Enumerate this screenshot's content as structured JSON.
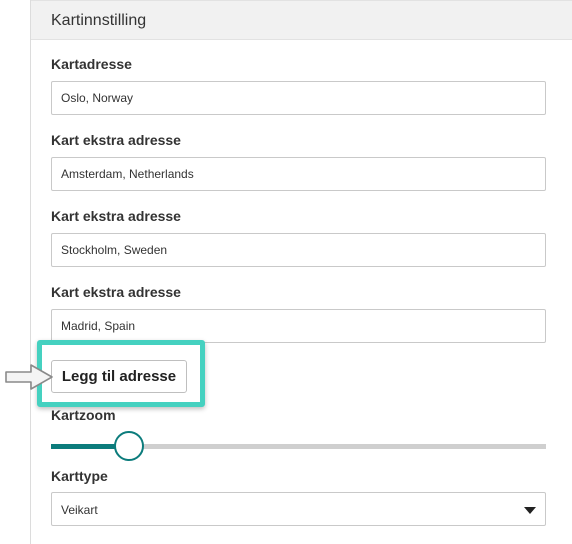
{
  "section": {
    "title": "Kartinnstilling"
  },
  "map_address": {
    "label": "Kartadresse",
    "value": "Oslo, Norway"
  },
  "extra_addresses": [
    {
      "label": "Kart ekstra adresse",
      "value": "Amsterdam, Netherlands"
    },
    {
      "label": "Kart ekstra adresse",
      "value": "Stockholm, Sweden"
    },
    {
      "label": "Kart ekstra adresse",
      "value": "Madrid, Spain"
    }
  ],
  "add_button": {
    "label": "Legg til adresse"
  },
  "zoom": {
    "label": "Kartzoom",
    "level_fraction": 0.16
  },
  "map_type": {
    "label": "Karttype",
    "selected": "Veikart"
  },
  "colors": {
    "accent": "#0c7c7c",
    "highlight": "#45d1c0"
  },
  "icons": {
    "pointer": "arrow-right-icon",
    "select": "caret-down-icon"
  }
}
